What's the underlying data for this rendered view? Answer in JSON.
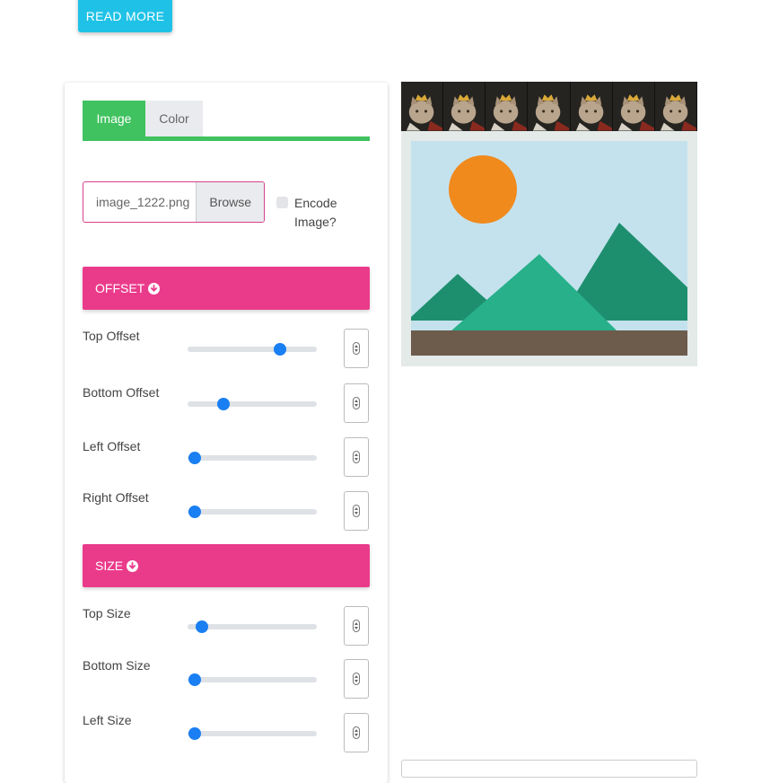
{
  "read_more_button": "READ MORE",
  "tabs": [
    {
      "label": "Image",
      "active": true
    },
    {
      "label": "Color",
      "active": false
    }
  ],
  "file_input": {
    "file_name": "image_1222.png",
    "browse_label": "Browse"
  },
  "encode_checkbox": {
    "label": "Encode Image?",
    "checked": false
  },
  "sections": {
    "offset": {
      "title": "OFFSET",
      "rows": [
        {
          "label": "Top Offset",
          "value": 0.74
        },
        {
          "label": "Bottom Offset",
          "value": 0.25
        },
        {
          "label": "Left Offset",
          "value": 0.0
        },
        {
          "label": "Right Offset",
          "value": 0.0
        }
      ]
    },
    "size": {
      "title": "SIZE",
      "rows": [
        {
          "label": "Top Size",
          "value": 0.06
        },
        {
          "label": "Bottom Size",
          "value": 0.0
        },
        {
          "label": "Left Size",
          "value": 0.0
        }
      ]
    }
  },
  "colors": {
    "tab_active": "#3fc25f",
    "section_header": "#ea3b8b",
    "slider_thumb": "#1a7ff2",
    "read_more": "#1fc2e6"
  },
  "icons": {
    "section_toggle": "chevron-circle-down-icon",
    "spinner": "number-spinner-icon",
    "preview_strip": "cat-image-thumbnail",
    "preview_image": "landscape-placeholder-image"
  }
}
